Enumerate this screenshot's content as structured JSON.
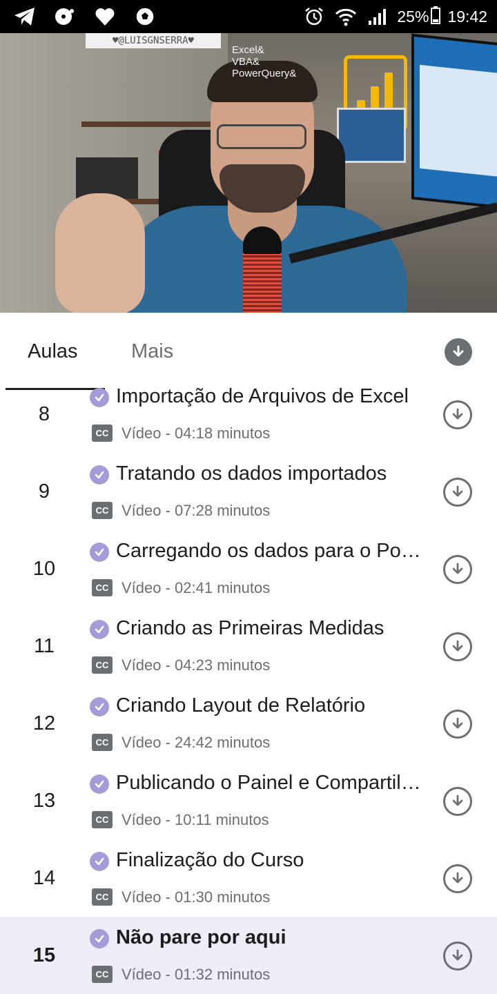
{
  "status_bar": {
    "battery": "25%",
    "time": "19:42",
    "left_icons": [
      "telegram-icon",
      "music-disc-icon",
      "heart-icon",
      "soccer-ball-icon"
    ],
    "right_icons": [
      "alarm-icon",
      "wifi-icon",
      "signal-icon",
      "battery-icon"
    ]
  },
  "video": {
    "sign_text": "♥@LUISGNSERRA♥",
    "overlay_text": "Excel&\nVBA&\nPowerQuery&"
  },
  "tabs": {
    "items": [
      {
        "label": "Aulas",
        "active": true
      },
      {
        "label": "Mais",
        "active": false
      }
    ],
    "download_all_icon": "download-circle-filled-icon"
  },
  "lectures": [
    {
      "number": "8",
      "title": "Importação de Arquivos de Excel",
      "cc": "CC",
      "meta": "Vídeo - 04:18 minutos",
      "completed": true,
      "current": false
    },
    {
      "number": "9",
      "title": "Tratando os dados importados",
      "cc": "CC",
      "meta": "Vídeo - 07:28 minutos",
      "completed": true,
      "current": false
    },
    {
      "number": "10",
      "title": "Carregando os dados para o Power BI",
      "cc": "CC",
      "meta": "Vídeo - 02:41 minutos",
      "completed": true,
      "current": false
    },
    {
      "number": "11",
      "title": "Criando as Primeiras Medidas",
      "cc": "CC",
      "meta": "Vídeo - 04:23 minutos",
      "completed": true,
      "current": false
    },
    {
      "number": "12",
      "title": "Criando Layout de Relatório",
      "cc": "CC",
      "meta": "Vídeo - 24:42 minutos",
      "completed": true,
      "current": false
    },
    {
      "number": "13",
      "title": "Publicando o Painel e Compartilhando",
      "cc": "CC",
      "meta": "Vídeo - 10:11 minutos",
      "completed": true,
      "current": false
    },
    {
      "number": "14",
      "title": "Finalização do Curso",
      "cc": "CC",
      "meta": "Vídeo - 01:30 minutos",
      "completed": true,
      "current": false
    },
    {
      "number": "15",
      "title": "Não pare por aqui",
      "cc": "CC",
      "meta": "Vídeo - 01:32 minutos",
      "completed": true,
      "current": true
    }
  ],
  "colors": {
    "check_purple": "#a49bd9",
    "current_row_bg": "#edecf7",
    "grey_text": "#6a6f73"
  }
}
